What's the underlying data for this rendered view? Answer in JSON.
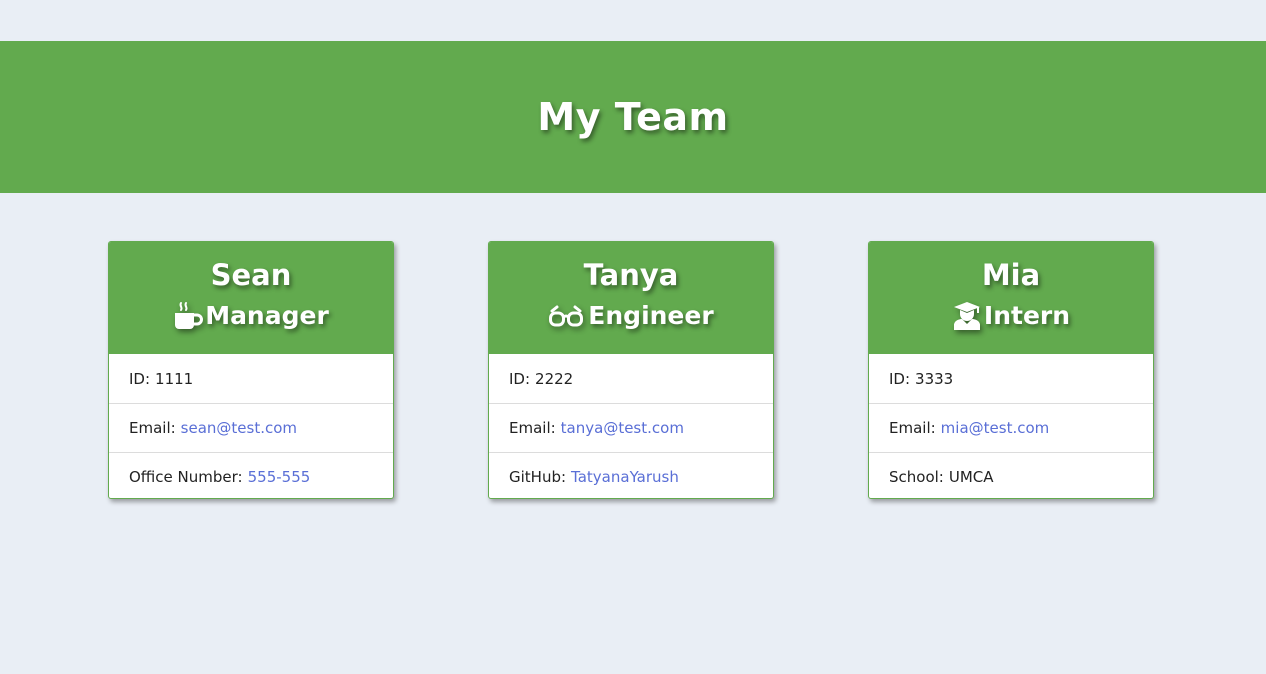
{
  "header": {
    "title": "My Team"
  },
  "colors": {
    "accent": "#62aa4e",
    "background": "#e9eef5",
    "link": "#5a6fd6"
  },
  "team": [
    {
      "name": "Sean",
      "role": "Manager",
      "icon": "coffee-mug-icon",
      "id_label": "ID:",
      "id_value": "1111",
      "email_label": "Email:",
      "email_value": "sean@test.com",
      "extra_label": "Office Number:",
      "extra_value": "555-555"
    },
    {
      "name": "Tanya",
      "role": "Engineer",
      "icon": "glasses-icon",
      "id_label": "ID:",
      "id_value": "2222",
      "email_label": "Email:",
      "email_value": "tanya@test.com",
      "extra_label": "GitHub:",
      "extra_value": "TatyanaYarush"
    },
    {
      "name": "Mia",
      "role": "Intern",
      "icon": "graduate-icon",
      "id_label": "ID:",
      "id_value": "3333",
      "email_label": "Email:",
      "email_value": "mia@test.com",
      "extra_label": "School:",
      "extra_value": "UMCA"
    }
  ]
}
